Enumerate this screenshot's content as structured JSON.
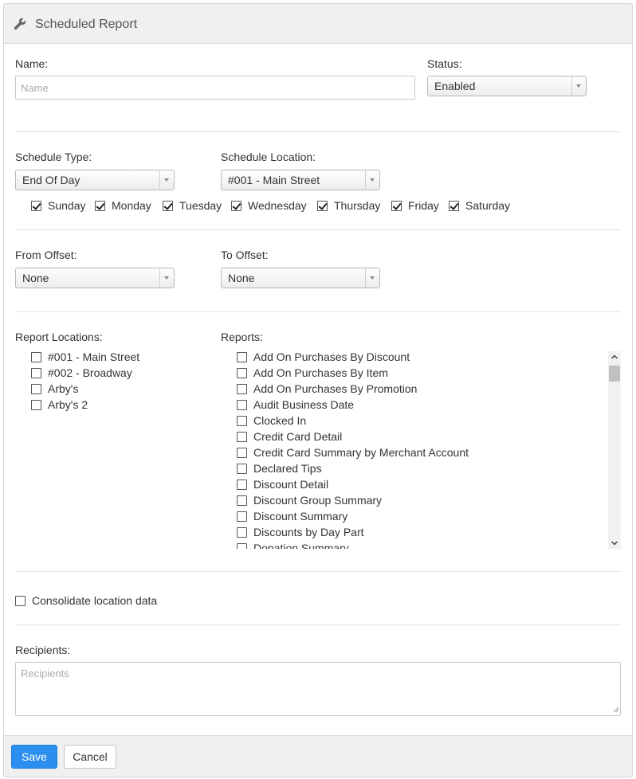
{
  "header": {
    "title": "Scheduled Report",
    "icon": "wrench-icon"
  },
  "name": {
    "label": "Name:",
    "placeholder": "Name",
    "value": ""
  },
  "status": {
    "label": "Status:",
    "selected": "Enabled"
  },
  "schedule_type": {
    "label": "Schedule Type:",
    "selected": "End Of Day"
  },
  "schedule_location": {
    "label": "Schedule Location:",
    "selected": "#001 - Main Street"
  },
  "days": [
    {
      "label": "Sunday",
      "checked": true
    },
    {
      "label": "Monday",
      "checked": true
    },
    {
      "label": "Tuesday",
      "checked": true
    },
    {
      "label": "Wednesday",
      "checked": true
    },
    {
      "label": "Thursday",
      "checked": true
    },
    {
      "label": "Friday",
      "checked": true
    },
    {
      "label": "Saturday",
      "checked": true
    }
  ],
  "from_offset": {
    "label": "From Offset:",
    "selected": "None"
  },
  "to_offset": {
    "label": "To Offset:",
    "selected": "None"
  },
  "report_locations": {
    "label": "Report Locations:",
    "items": [
      {
        "label": "#001 - Main Street",
        "checked": false
      },
      {
        "label": "#002 - Broadway",
        "checked": false
      },
      {
        "label": "Arby's",
        "checked": false
      },
      {
        "label": "Arby's 2",
        "checked": false
      }
    ]
  },
  "reports": {
    "label": "Reports:",
    "items": [
      {
        "label": "Add On Purchases By Discount",
        "checked": false
      },
      {
        "label": "Add On Purchases By Item",
        "checked": false
      },
      {
        "label": "Add On Purchases By Promotion",
        "checked": false
      },
      {
        "label": "Audit Business Date",
        "checked": false
      },
      {
        "label": "Clocked In",
        "checked": false
      },
      {
        "label": "Credit Card Detail",
        "checked": false
      },
      {
        "label": "Credit Card Summary by Merchant Account",
        "checked": false
      },
      {
        "label": "Declared Tips",
        "checked": false
      },
      {
        "label": "Discount Detail",
        "checked": false
      },
      {
        "label": "Discount Group Summary",
        "checked": false
      },
      {
        "label": "Discount Summary",
        "checked": false
      },
      {
        "label": "Discounts by Day Part",
        "checked": false
      },
      {
        "label": "Donation Summary",
        "checked": false
      }
    ]
  },
  "consolidate": {
    "label": "Consolidate location data",
    "checked": false
  },
  "recipients": {
    "label": "Recipients:",
    "placeholder": "Recipients",
    "value": ""
  },
  "footer": {
    "save_label": "Save",
    "cancel_label": "Cancel"
  },
  "colors": {
    "primary": "#2b8ff0",
    "header_bg": "#f0f0f0",
    "border": "#d4d4d4"
  }
}
